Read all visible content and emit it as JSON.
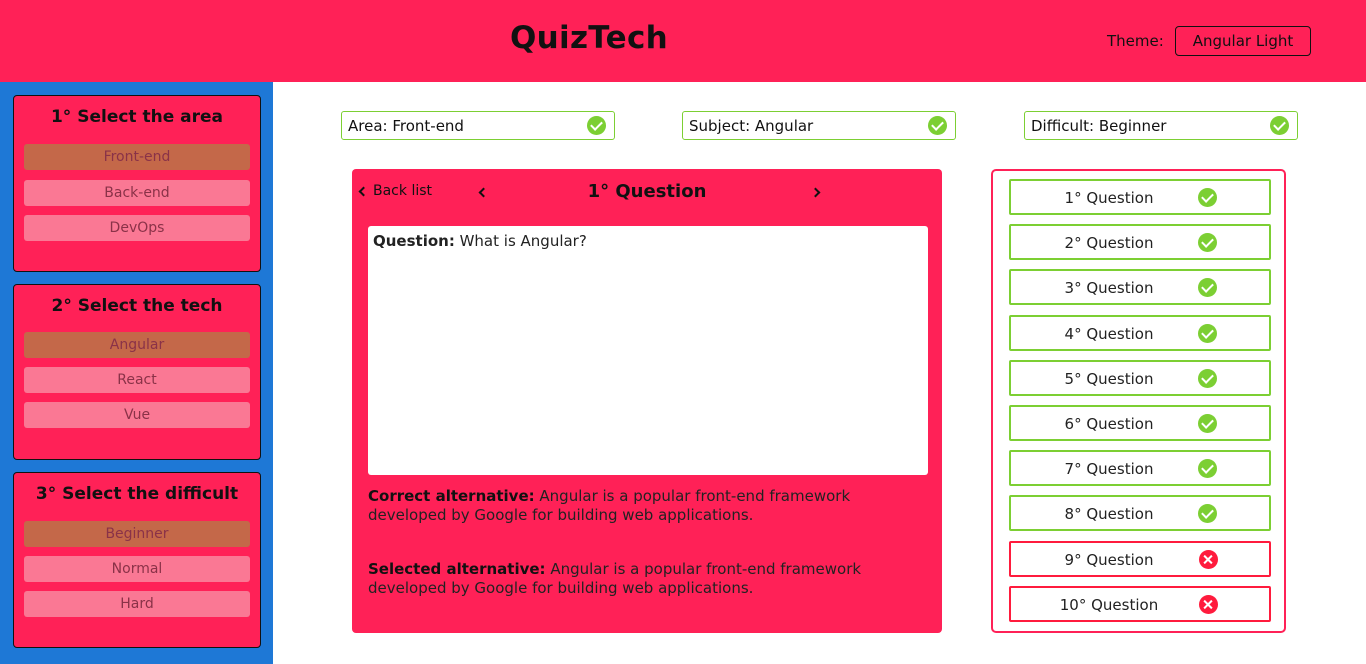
{
  "header": {
    "title": "QuizTech",
    "theme_label": "Theme:",
    "theme_value": "Angular Light"
  },
  "sidebar": {
    "steps": [
      {
        "title": "1° Select the area",
        "options": [
          "Front-end",
          "Back-end",
          "DevOps"
        ],
        "selected": "Front-end"
      },
      {
        "title": "2° Select the tech",
        "options": [
          "Angular",
          "React",
          "Vue"
        ],
        "selected": "Angular"
      },
      {
        "title": "3° Select the difficult",
        "options": [
          "Beginner",
          "Normal",
          "Hard"
        ],
        "selected": "Beginner"
      }
    ]
  },
  "filters": [
    {
      "label": "Area: Front-end",
      "status": "check-icon"
    },
    {
      "label": "Subject: Angular",
      "status": "check-icon"
    },
    {
      "label": "Difficult: Beginner",
      "status": "check-icon"
    }
  ],
  "card": {
    "back_label": "Back list",
    "title": "1° Question",
    "question_label": "Question:",
    "question_text": " What is Angular?",
    "correct_label": "Correct alternative:",
    "correct_text": " Angular is a popular front-end framework developed by Google for building web applications.",
    "selected_label": "Selected alternative:",
    "selected_text": " Angular is a popular front-end framework developed by Google for building web applications."
  },
  "question_list": [
    {
      "label": "1° Question",
      "result": "correct"
    },
    {
      "label": "2° Question",
      "result": "correct"
    },
    {
      "label": "3° Question",
      "result": "correct"
    },
    {
      "label": "4° Question",
      "result": "correct"
    },
    {
      "label": "5° Question",
      "result": "correct"
    },
    {
      "label": "6° Question",
      "result": "correct"
    },
    {
      "label": "7° Question",
      "result": "correct"
    },
    {
      "label": "8° Question",
      "result": "correct"
    },
    {
      "label": "9° Question",
      "result": "wrong"
    },
    {
      "label": "10° Question",
      "result": "wrong"
    }
  ],
  "colors": {
    "primary": "#ff2157",
    "sidebar": "#1e78d6",
    "correct": "#7ccf33",
    "wrong": "#ff1b3d",
    "option": "#fa7894",
    "option_selected": "#c46849"
  }
}
